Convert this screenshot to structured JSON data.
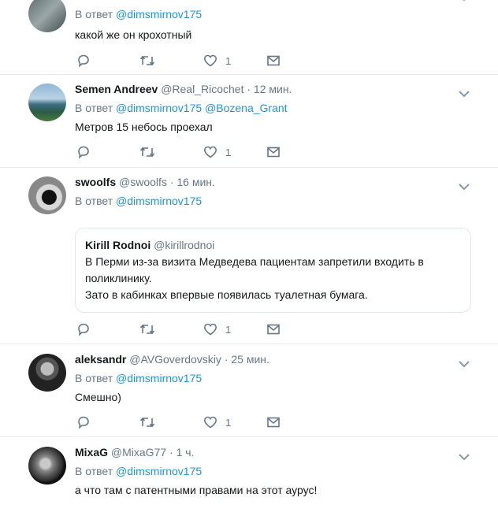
{
  "tweets": [
    {
      "name": "",
      "handle": "",
      "time": "",
      "reply_prefix": "В ответ",
      "mentions": [
        "@dimsmirnov175"
      ],
      "text": "какой же он крохотный",
      "likes": "1"
    },
    {
      "name": "Semen Andreev",
      "handle": "@Real_Ricochet",
      "time": "· 12 мин.",
      "reply_prefix": "В ответ",
      "mentions": [
        "@dimsmirnov175",
        "@Bozena_Grant"
      ],
      "text": "Метров 15 небось проехал",
      "likes": "1"
    },
    {
      "name": "swoolfs",
      "handle": "@swoolfs",
      "time": "· 16 мин.",
      "reply_prefix": "В ответ",
      "mentions": [
        "@dimsmirnov175"
      ],
      "text": "",
      "likes": "1",
      "quote": {
        "name": "Kirill Rodnoi",
        "handle": "@kirillrodnoi",
        "lines": [
          "В Перми из-за визита Медведева пациентам запретили входить в",
          "поликлинику.",
          "Зато в кабинках впервые появилась туалетная бумага."
        ]
      }
    },
    {
      "name": "aleksandr",
      "handle": "@AVGoverdovskiy",
      "time": "· 25 мин.",
      "reply_prefix": "В ответ",
      "mentions": [
        "@dimsmirnov175"
      ],
      "text": "Смешно)",
      "likes": "1"
    },
    {
      "name": "MixaG",
      "handle": "@MixaG77",
      "time": "· 1 ч.",
      "reply_prefix": "В ответ",
      "mentions": [
        "@dimsmirnov175"
      ],
      "text": "а что там с патентными правами на этот аурус!",
      "likes": ""
    }
  ],
  "colors": {
    "link": "#1b95e0",
    "secondary": "#657786",
    "border": "#e6ecf0"
  },
  "icons": [
    "reply-icon",
    "retweet-icon",
    "like-icon",
    "message-icon",
    "chevron-down-icon"
  ]
}
